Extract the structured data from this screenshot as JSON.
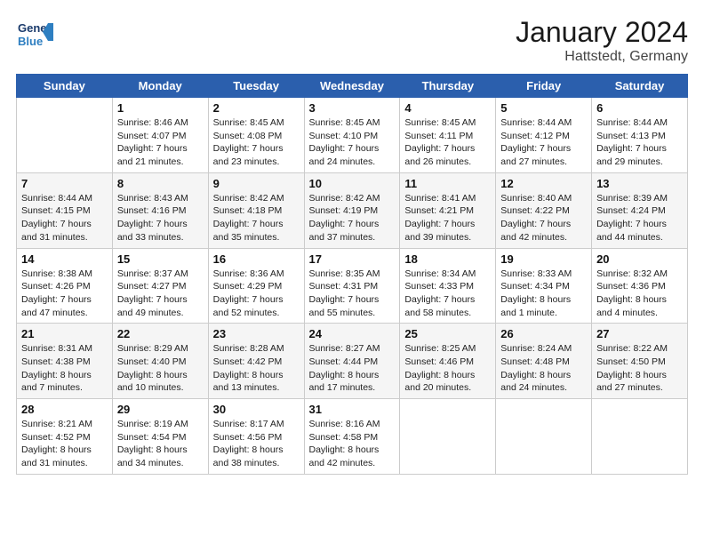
{
  "header": {
    "logo_general": "General",
    "logo_blue": "Blue",
    "month": "January 2024",
    "location": "Hattstedt, Germany"
  },
  "days_of_week": [
    "Sunday",
    "Monday",
    "Tuesday",
    "Wednesday",
    "Thursday",
    "Friday",
    "Saturday"
  ],
  "weeks": [
    [
      {
        "day": "",
        "sunrise": "",
        "sunset": "",
        "daylight": ""
      },
      {
        "day": "1",
        "sunrise": "Sunrise: 8:46 AM",
        "sunset": "Sunset: 4:07 PM",
        "daylight": "Daylight: 7 hours and 21 minutes."
      },
      {
        "day": "2",
        "sunrise": "Sunrise: 8:45 AM",
        "sunset": "Sunset: 4:08 PM",
        "daylight": "Daylight: 7 hours and 23 minutes."
      },
      {
        "day": "3",
        "sunrise": "Sunrise: 8:45 AM",
        "sunset": "Sunset: 4:10 PM",
        "daylight": "Daylight: 7 hours and 24 minutes."
      },
      {
        "day": "4",
        "sunrise": "Sunrise: 8:45 AM",
        "sunset": "Sunset: 4:11 PM",
        "daylight": "Daylight: 7 hours and 26 minutes."
      },
      {
        "day": "5",
        "sunrise": "Sunrise: 8:44 AM",
        "sunset": "Sunset: 4:12 PM",
        "daylight": "Daylight: 7 hours and 27 minutes."
      },
      {
        "day": "6",
        "sunrise": "Sunrise: 8:44 AM",
        "sunset": "Sunset: 4:13 PM",
        "daylight": "Daylight: 7 hours and 29 minutes."
      }
    ],
    [
      {
        "day": "7",
        "sunrise": "Sunrise: 8:44 AM",
        "sunset": "Sunset: 4:15 PM",
        "daylight": "Daylight: 7 hours and 31 minutes."
      },
      {
        "day": "8",
        "sunrise": "Sunrise: 8:43 AM",
        "sunset": "Sunset: 4:16 PM",
        "daylight": "Daylight: 7 hours and 33 minutes."
      },
      {
        "day": "9",
        "sunrise": "Sunrise: 8:42 AM",
        "sunset": "Sunset: 4:18 PM",
        "daylight": "Daylight: 7 hours and 35 minutes."
      },
      {
        "day": "10",
        "sunrise": "Sunrise: 8:42 AM",
        "sunset": "Sunset: 4:19 PM",
        "daylight": "Daylight: 7 hours and 37 minutes."
      },
      {
        "day": "11",
        "sunrise": "Sunrise: 8:41 AM",
        "sunset": "Sunset: 4:21 PM",
        "daylight": "Daylight: 7 hours and 39 minutes."
      },
      {
        "day": "12",
        "sunrise": "Sunrise: 8:40 AM",
        "sunset": "Sunset: 4:22 PM",
        "daylight": "Daylight: 7 hours and 42 minutes."
      },
      {
        "day": "13",
        "sunrise": "Sunrise: 8:39 AM",
        "sunset": "Sunset: 4:24 PM",
        "daylight": "Daylight: 7 hours and 44 minutes."
      }
    ],
    [
      {
        "day": "14",
        "sunrise": "Sunrise: 8:38 AM",
        "sunset": "Sunset: 4:26 PM",
        "daylight": "Daylight: 7 hours and 47 minutes."
      },
      {
        "day": "15",
        "sunrise": "Sunrise: 8:37 AM",
        "sunset": "Sunset: 4:27 PM",
        "daylight": "Daylight: 7 hours and 49 minutes."
      },
      {
        "day": "16",
        "sunrise": "Sunrise: 8:36 AM",
        "sunset": "Sunset: 4:29 PM",
        "daylight": "Daylight: 7 hours and 52 minutes."
      },
      {
        "day": "17",
        "sunrise": "Sunrise: 8:35 AM",
        "sunset": "Sunset: 4:31 PM",
        "daylight": "Daylight: 7 hours and 55 minutes."
      },
      {
        "day": "18",
        "sunrise": "Sunrise: 8:34 AM",
        "sunset": "Sunset: 4:33 PM",
        "daylight": "Daylight: 7 hours and 58 minutes."
      },
      {
        "day": "19",
        "sunrise": "Sunrise: 8:33 AM",
        "sunset": "Sunset: 4:34 PM",
        "daylight": "Daylight: 8 hours and 1 minute."
      },
      {
        "day": "20",
        "sunrise": "Sunrise: 8:32 AM",
        "sunset": "Sunset: 4:36 PM",
        "daylight": "Daylight: 8 hours and 4 minutes."
      }
    ],
    [
      {
        "day": "21",
        "sunrise": "Sunrise: 8:31 AM",
        "sunset": "Sunset: 4:38 PM",
        "daylight": "Daylight: 8 hours and 7 minutes."
      },
      {
        "day": "22",
        "sunrise": "Sunrise: 8:29 AM",
        "sunset": "Sunset: 4:40 PM",
        "daylight": "Daylight: 8 hours and 10 minutes."
      },
      {
        "day": "23",
        "sunrise": "Sunrise: 8:28 AM",
        "sunset": "Sunset: 4:42 PM",
        "daylight": "Daylight: 8 hours and 13 minutes."
      },
      {
        "day": "24",
        "sunrise": "Sunrise: 8:27 AM",
        "sunset": "Sunset: 4:44 PM",
        "daylight": "Daylight: 8 hours and 17 minutes."
      },
      {
        "day": "25",
        "sunrise": "Sunrise: 8:25 AM",
        "sunset": "Sunset: 4:46 PM",
        "daylight": "Daylight: 8 hours and 20 minutes."
      },
      {
        "day": "26",
        "sunrise": "Sunrise: 8:24 AM",
        "sunset": "Sunset: 4:48 PM",
        "daylight": "Daylight: 8 hours and 24 minutes."
      },
      {
        "day": "27",
        "sunrise": "Sunrise: 8:22 AM",
        "sunset": "Sunset: 4:50 PM",
        "daylight": "Daylight: 8 hours and 27 minutes."
      }
    ],
    [
      {
        "day": "28",
        "sunrise": "Sunrise: 8:21 AM",
        "sunset": "Sunset: 4:52 PM",
        "daylight": "Daylight: 8 hours and 31 minutes."
      },
      {
        "day": "29",
        "sunrise": "Sunrise: 8:19 AM",
        "sunset": "Sunset: 4:54 PM",
        "daylight": "Daylight: 8 hours and 34 minutes."
      },
      {
        "day": "30",
        "sunrise": "Sunrise: 8:17 AM",
        "sunset": "Sunset: 4:56 PM",
        "daylight": "Daylight: 8 hours and 38 minutes."
      },
      {
        "day": "31",
        "sunrise": "Sunrise: 8:16 AM",
        "sunset": "Sunset: 4:58 PM",
        "daylight": "Daylight: 8 hours and 42 minutes."
      },
      {
        "day": "",
        "sunrise": "",
        "sunset": "",
        "daylight": ""
      },
      {
        "day": "",
        "sunrise": "",
        "sunset": "",
        "daylight": ""
      },
      {
        "day": "",
        "sunrise": "",
        "sunset": "",
        "daylight": ""
      }
    ]
  ]
}
